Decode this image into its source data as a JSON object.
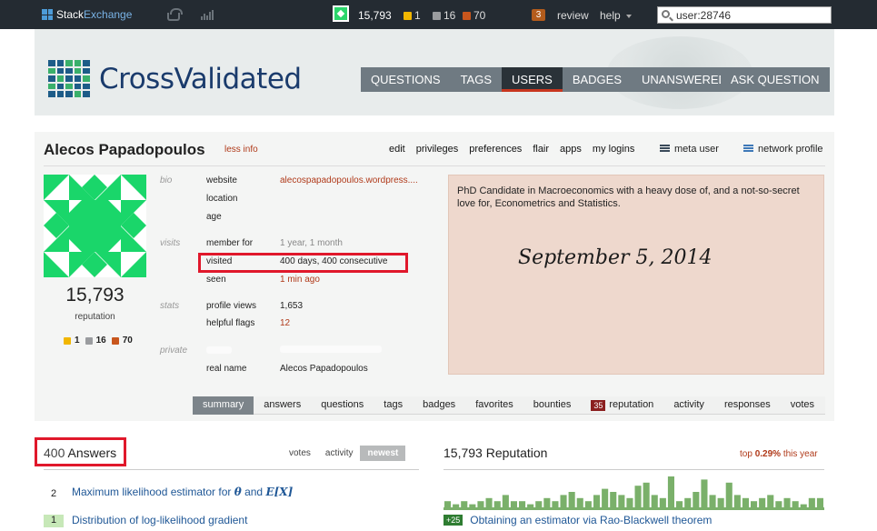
{
  "topbar": {
    "brand_a": "Stack",
    "brand_b": "Exchange",
    "reputation": "15,793",
    "gold": "1",
    "silver": "16",
    "bronze": "70",
    "review_count": "3",
    "review": "review",
    "help": "help",
    "search_value": "user:28746",
    "colors": {
      "bg": "#242b32",
      "gold": "#f1b600",
      "silver": "#9a9c9f",
      "bronze": "#c8561d"
    }
  },
  "header": {
    "site_name": "CrossValidated",
    "nav": [
      "QUESTIONS",
      "TAGS",
      "USERS",
      "BADGES",
      "UNANSWERED"
    ],
    "active_nav": "USERS",
    "ask": "ASK QUESTION"
  },
  "profile": {
    "name": "Alecos Papadopoulos",
    "less_info": "less info",
    "actions": [
      "edit",
      "privileges",
      "preferences",
      "flair",
      "apps",
      "my logins"
    ],
    "meta_user": "meta user",
    "network_profile": "network profile",
    "reputation": "15,793",
    "reputation_label": "reputation",
    "badges": {
      "gold": "1",
      "silver": "16",
      "bronze": "70"
    },
    "sections": {
      "bio": "bio",
      "visits": "visits",
      "stats": "stats",
      "private": "private"
    },
    "rows": {
      "website_label": "website",
      "website_value": "alecospapadopoulos.wordpress....",
      "location_label": "location",
      "age_label": "age",
      "member_for_label": "member for",
      "member_for_value": "1 year, 1 month",
      "visited_label": "visited",
      "visited_value": "400 days, 400 consecutive",
      "seen_label": "seen",
      "seen_value": "1 min ago",
      "profile_views_label": "profile views",
      "profile_views_value": "1,653",
      "helpful_flags_label": "helpful flags",
      "helpful_flags_value": "12",
      "real_name_label": "real name",
      "real_name_value": "Alecos Papadopoulos"
    },
    "bio_text": "PhD Candidate in Macroeconomics with a heavy dose of, and a not-so-secret love for, Econometrics and Statistics.",
    "bio_date": "September 5, 2014",
    "tabs": [
      "summary",
      "answers",
      "questions",
      "tags",
      "badges",
      "favorites",
      "bounties",
      "reputation",
      "activity",
      "responses",
      "votes"
    ],
    "active_tab": "summary",
    "reputation_tab_count": "35"
  },
  "answers": {
    "count": "400",
    "label": "Answers",
    "sort": [
      "votes",
      "activity",
      "newest"
    ],
    "active_sort": "newest",
    "items": [
      {
        "score": "2",
        "title_a": "Maximum likelihood estimator for ",
        "math_a": "θ",
        "title_b": " and ",
        "math_b": "E[X]",
        "accepted": false
      },
      {
        "score": "1",
        "title_a": "Distribution of log-likelihood gradient",
        "accepted": true
      }
    ]
  },
  "reputation_panel": {
    "value": "15,793",
    "label": "Reputation",
    "top_a": "top ",
    "top_pct": "0.29%",
    "top_b": " this year",
    "bars": [
      2,
      1,
      2,
      1,
      2,
      3,
      2,
      4,
      2,
      2,
      1,
      2,
      3,
      2,
      4,
      5,
      3,
      2,
      4,
      6,
      5,
      4,
      3,
      7,
      8,
      4,
      3,
      10,
      2,
      3,
      5,
      9,
      4,
      3,
      8,
      4,
      3,
      2,
      3,
      4,
      2,
      3,
      2,
      1,
      3,
      3
    ],
    "bar_color": "#7ab06a",
    "event_points": "+25",
    "event_title": "Obtaining an estimator via Rao-Blackwell theorem"
  }
}
